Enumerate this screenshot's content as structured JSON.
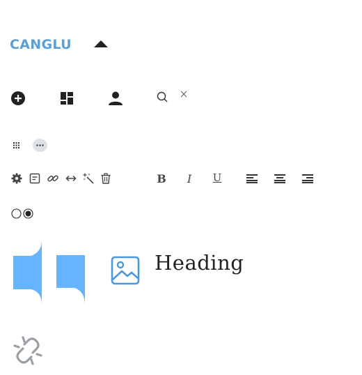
{
  "brand": {
    "name": "CANGLU"
  },
  "toolbar_top": {
    "icons": [
      "add-circle-icon",
      "dashboard-icon",
      "user-icon",
      "search-icon",
      "close-icon"
    ]
  },
  "block_tools": {
    "icons": [
      "drag-handle-icon",
      "more-options-icon"
    ]
  },
  "editor_toolbar": {
    "icons": [
      "settings-icon",
      "document-icon",
      "link-icon",
      "resize-horizontal-icon",
      "magic-wand-icon",
      "trash-icon"
    ],
    "format": {
      "bold": "B",
      "italic": "I",
      "underline": "U"
    },
    "align": [
      "align-left-icon",
      "align-center-icon",
      "align-right-icon"
    ]
  },
  "radio_options": [
    "radio-unchecked",
    "radio-checked"
  ],
  "preview": {
    "heading": "Heading"
  },
  "colors": {
    "brand": "#5aa0d8",
    "accent_blue": "#66b3ff",
    "image_icon": "#4a97dc",
    "unlink_icon": "#9aa0a6",
    "icon_dark": "#333333"
  }
}
